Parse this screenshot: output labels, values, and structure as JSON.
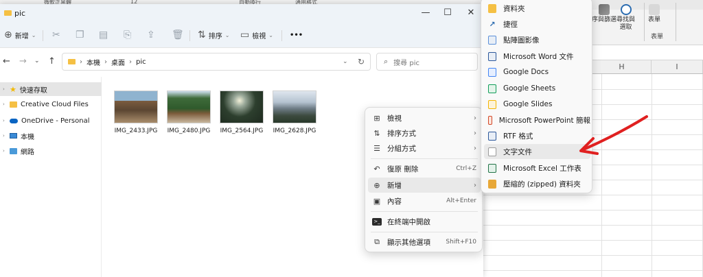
{
  "excel": {
    "ribbon": {
      "sort_filter_label": "序與篩選",
      "find_select_label": "尋找與",
      "find_select_label2": "選取",
      "table_label": "表單",
      "group_label": "表單",
      "top_items": [
        "自動換行",
        "通用格式"
      ]
    },
    "columns": [
      "H",
      "I"
    ],
    "column_g_partial": ""
  },
  "topstrip": {
    "text": "微軟正黑體",
    "size": "12"
  },
  "explorer": {
    "title": "pic",
    "window_controls": {
      "minimize": "—",
      "maximize": "☐",
      "close": "✕"
    },
    "toolbar": {
      "new_label": "新增",
      "sort_label": "排序",
      "view_label": "檢視",
      "more": "•••"
    },
    "breadcrumb": [
      "本機",
      "桌面",
      "pic"
    ],
    "search_placeholder": "搜尋 pic",
    "nav": [
      {
        "label": "快速存取",
        "icon": "star-icon",
        "selected": true
      },
      {
        "label": "Creative Cloud Files",
        "icon": "creative-cloud-icon"
      },
      {
        "label": "OneDrive - Personal",
        "icon": "onedrive-icon"
      },
      {
        "label": "本機",
        "icon": "pc-icon"
      },
      {
        "label": "網路",
        "icon": "network-icon"
      }
    ],
    "files": [
      {
        "name": "IMG_2433.JPG"
      },
      {
        "name": "IMG_2480.JPG"
      },
      {
        "name": "IMG_2564.JPG"
      },
      {
        "name": "IMG_2628.JPG"
      }
    ]
  },
  "context_menu": {
    "items": [
      {
        "label": "檢視",
        "icon": "grid-icon",
        "submenu": true
      },
      {
        "label": "排序方式",
        "icon": "sort-icon",
        "submenu": true
      },
      {
        "label": "分組方式",
        "icon": "group-icon",
        "submenu": true
      },
      {
        "label": "復原 刪除",
        "icon": "undo-icon",
        "shortcut": "Ctrl+Z"
      },
      {
        "label": "新增",
        "icon": "plus-circle-icon",
        "submenu": true,
        "hover": true
      },
      {
        "label": "內容",
        "icon": "properties-icon",
        "shortcut": "Alt+Enter"
      },
      {
        "label": "在終端中開啟",
        "icon": "terminal-icon"
      },
      {
        "label": "顯示其他選項",
        "icon": "more-options-icon",
        "shortcut": "Shift+F10"
      }
    ],
    "submenu_arrow": "›"
  },
  "new_submenu": {
    "items": [
      {
        "label": "資料夾",
        "icon": "folder-icon",
        "color": "#f5c044"
      },
      {
        "label": "捷徑",
        "icon": "shortcut-icon",
        "color": "#2b6cb0"
      },
      {
        "label": "點陣圖影像",
        "icon": "bitmap-icon",
        "color": "#5b8fd9"
      },
      {
        "label": "Microsoft Word 文件",
        "icon": "word-icon",
        "color": "#2b579a"
      },
      {
        "label": "Google Docs",
        "icon": "google-docs-icon",
        "color": "#4285f4"
      },
      {
        "label": "Google Sheets",
        "icon": "google-sheets-icon",
        "color": "#0f9d58"
      },
      {
        "label": "Google Slides",
        "icon": "google-slides-icon",
        "color": "#f4b400"
      },
      {
        "label": "Microsoft PowerPoint 簡報",
        "icon": "powerpoint-icon",
        "color": "#d24726"
      },
      {
        "label": "RTF 格式",
        "icon": "rtf-icon",
        "color": "#2b579a"
      },
      {
        "label": "文字文件",
        "icon": "text-doc-icon",
        "color": "#9a9a9a",
        "hover": true
      },
      {
        "label": "Microsoft Excel 工作表",
        "icon": "excel-icon",
        "color": "#217346"
      },
      {
        "label": "壓縮的 (zipped) 資料夾",
        "icon": "zip-folder-icon",
        "color": "#e8a838"
      }
    ]
  },
  "annotation": {
    "arrow_color": "#e02020"
  }
}
